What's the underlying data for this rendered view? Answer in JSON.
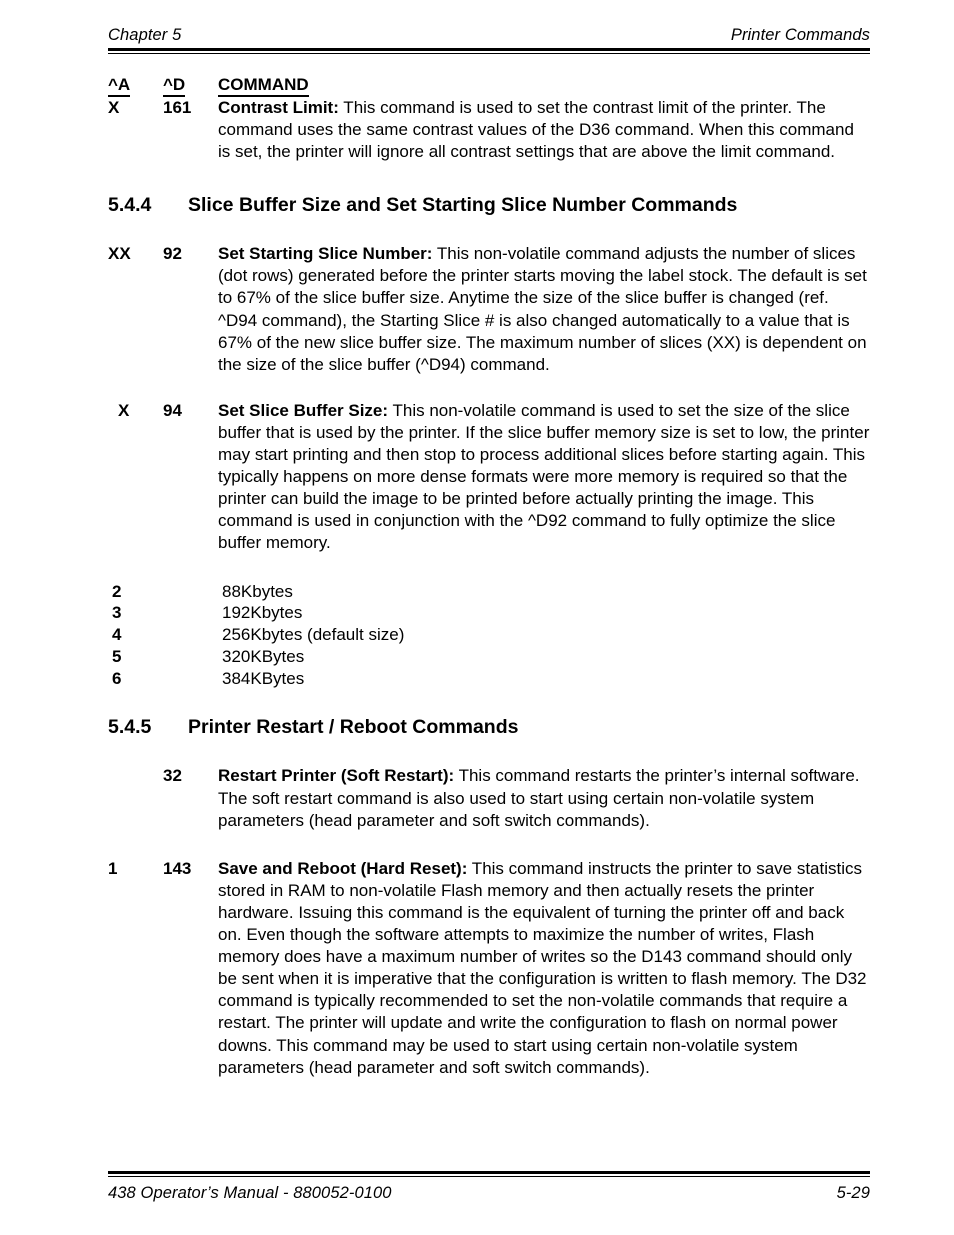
{
  "header": {
    "left": "Chapter 5",
    "right": "Printer Commands"
  },
  "footer": {
    "left": "438 Operator’s Manual - 880052-0100",
    "right": "5-29"
  },
  "command_table": {
    "headers": {
      "col_a": "^A",
      "col_d": "^D",
      "col_command": "COMMAND"
    },
    "rows": [
      {
        "col_a": "X",
        "col_d": "161",
        "title": "Contrast Limit:",
        "body": " This command is used to set the contrast limit of the printer.  The command uses the same contrast values of the D36 command.  When this command is set, the printer will ignore all contrast settings that are above the limit command."
      },
      {
        "col_a": "XX",
        "col_d": "92",
        "title": "Set Starting Slice Number:",
        "body": " This non-volatile command adjusts the number of slices (dot rows) generated before the printer starts moving the label stock.  The default is set to 67% of the slice buffer size.   Anytime the size of the slice buffer is changed (ref. ^D94 command), the Starting Slice # is also changed automatically to a value that is 67% of the new slice buffer size.   The maximum number of slices (XX) is dependent on the size of the slice buffer (^D94) command."
      },
      {
        "col_a": "X",
        "col_d": "94",
        "title": "Set Slice Buffer Size:",
        "body": "  This non-volatile command is used to set the size of the slice buffer that is used by the printer.  If the slice buffer memory size is set to low, the printer may start printing and then stop to process additional slices before starting again.  This typically happens on more dense formats were more memory is required so that the printer can build the image to be printed before actually printing the image.  This command is used in conjunction with the ^D92 command to fully optimize the slice buffer memory."
      },
      {
        "col_a": "",
        "col_d": "32",
        "title": "Restart Printer (Soft Restart):",
        "body": "  This command restarts the printer’s internal software.  The soft restart command is also used to start using certain non-volatile system parameters (head parameter and soft switch commands)."
      },
      {
        "col_a": "1",
        "col_d": "143",
        "title": "Save and Reboot (Hard Reset):",
        "body": "  This command instructs the printer to save statistics stored in RAM to non-volatile Flash memory and then actually resets the printer hardware.  Issuing this command is the equivalent of turning the printer off and back on.  Even though the software attempts to maximize the number of writes, Flash memory does have a maximum number of writes so the D143 command should only be sent when it is imperative that the configuration is written to flash memory.  The D32 command is typically recommended to set the non-volatile commands that require a restart.  The printer will update and write the configuration to flash on normal power downs.  This command may be used to start using certain non-volatile system parameters (head parameter and soft switch commands)."
      }
    ]
  },
  "sections": [
    {
      "number": "5.4.4",
      "title": "Slice Buffer Size and Set Starting Slice Number Commands"
    },
    {
      "number": "5.4.5",
      "title": "Printer Restart / Reboot Commands"
    }
  ],
  "buffer_sizes": [
    {
      "code": "2",
      "value": "88Kbytes"
    },
    {
      "code": "3",
      "value": "192Kbytes"
    },
    {
      "code": "4",
      "value": "256Kbytes (default size)"
    },
    {
      "code": "5",
      "value": "320KBytes"
    },
    {
      "code": "6",
      "value": "384KBytes"
    }
  ]
}
